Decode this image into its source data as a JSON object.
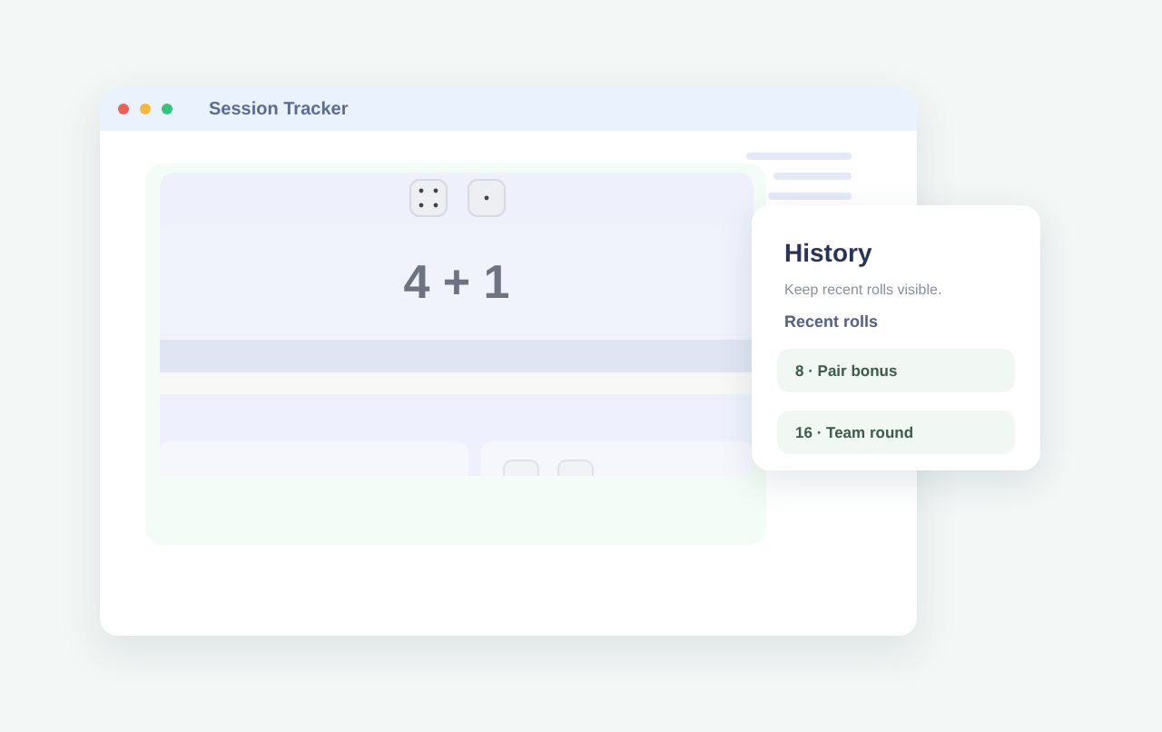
{
  "window": {
    "title": "Session Tracker"
  },
  "roller": {
    "dice": [
      {
        "kind": "four"
      },
      {
        "kind": "one"
      }
    ],
    "total": "4 + 1"
  },
  "history": {
    "title": "History",
    "subtitle": "Keep recent rolls visible.",
    "section": "Recent rolls",
    "rolls": [
      "8 · Pair bonus",
      "16 · Team round"
    ]
  }
}
